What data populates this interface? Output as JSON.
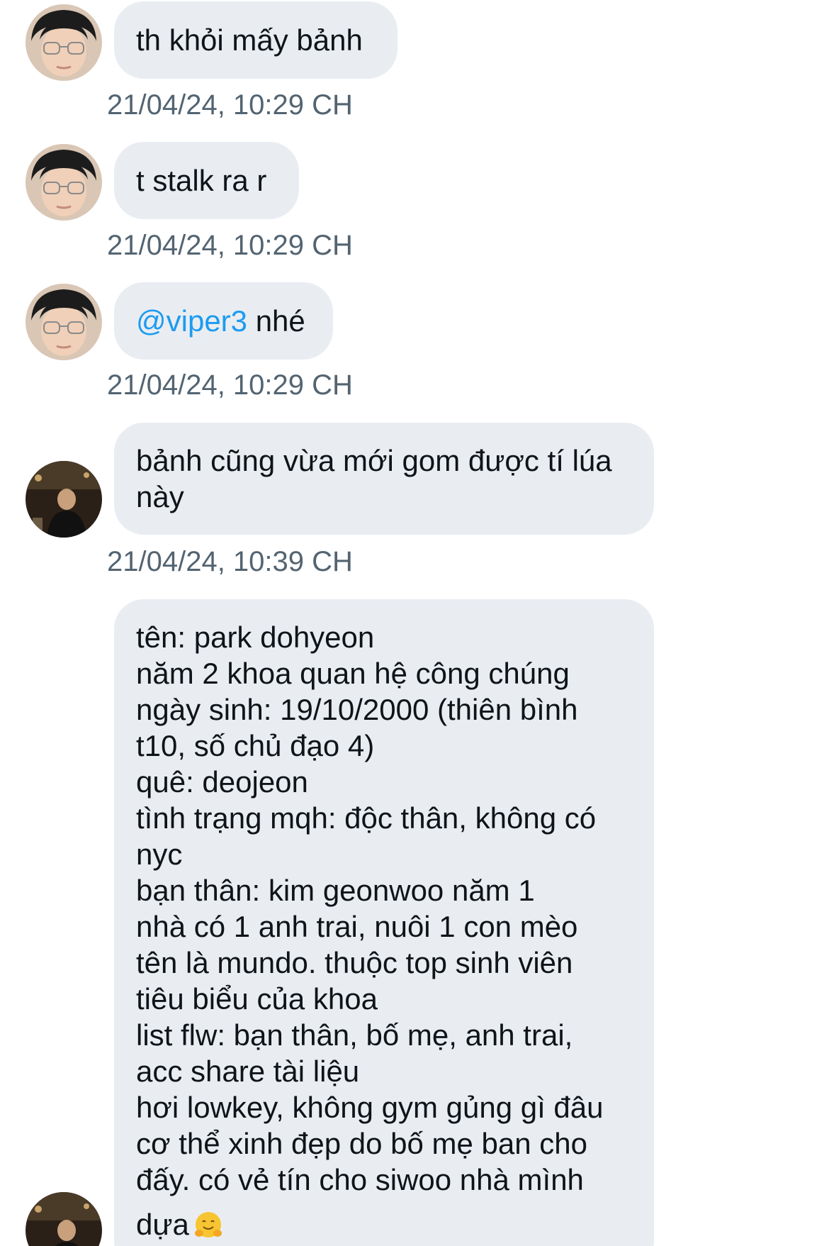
{
  "messages": [
    {
      "author": "avatar-glasses",
      "text": "th khỏi mấy bảnh",
      "timestamp": "21/04/24, 10:29 CH"
    },
    {
      "author": "avatar-glasses",
      "text": "t stalk ra r",
      "timestamp": "21/04/24, 10:29 CH"
    },
    {
      "author": "avatar-glasses",
      "mention": "@viper3",
      "text": " nhé",
      "timestamp": "21/04/24, 10:29 CH"
    },
    {
      "author": "avatar-dark",
      "lines": [
        "bảnh cũng vừa mới gom được tí lúa",
        "này"
      ],
      "timestamp": "21/04/24, 10:39 CH"
    },
    {
      "author": "avatar-dark",
      "lines": [
        "tên: park dohyeon",
        "năm 2 khoa quan hệ công chúng",
        "ngày sinh: 19/10/2000 (thiên bình",
        "t10, số chủ đạo 4)",
        "quê: deojeon",
        "tình trạng mqh: độc thân, không có",
        "nyc",
        "bạn thân: kim geonwoo năm 1",
        "nhà có 1 anh trai, nuôi 1 con mèo",
        "tên là mundo. thuộc top sinh viên",
        "tiêu biểu của khoa",
        "list flw: bạn thân, bố mẹ, anh trai,",
        "acc share tài liệu",
        "hơi lowkey, không gym gủng gì đâu",
        "cơ thể xinh đẹp do bố mẹ ban cho",
        "đấy. có vẻ tín cho siwoo nhà mình",
        "dựa"
      ],
      "trailing_emoji": "hugging-face-emoji"
    }
  ],
  "colors": {
    "bubble": "#e9edf2",
    "text": "#0f1419",
    "mention": "#1d9bf0",
    "timestamp": "#536471"
  }
}
